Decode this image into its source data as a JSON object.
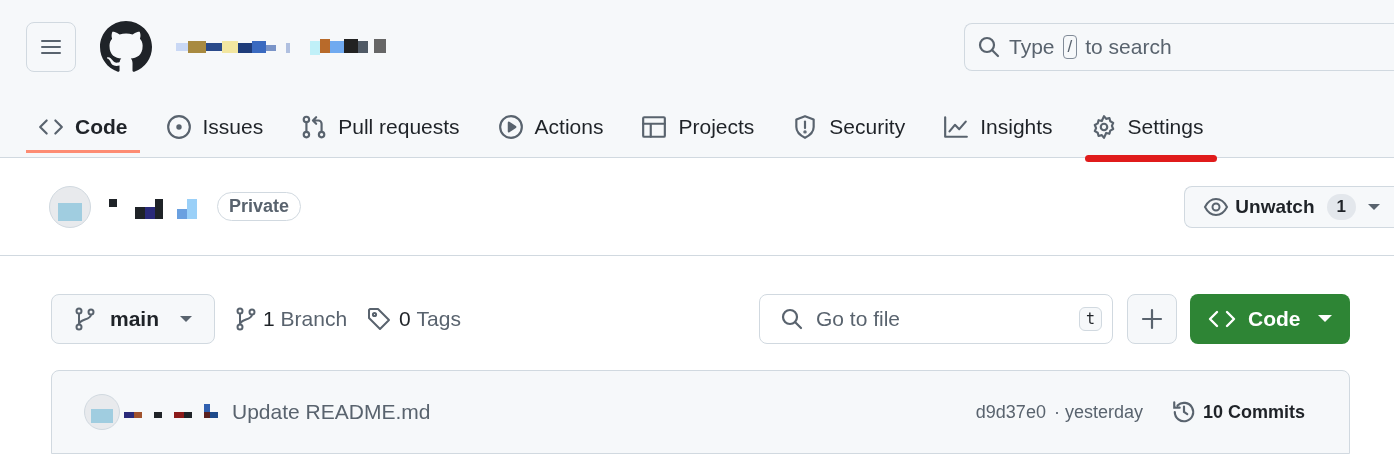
{
  "header": {
    "search": {
      "placeholder_before": "Type",
      "shortcut": "/",
      "placeholder_after": "to search"
    }
  },
  "tabs": [
    {
      "label": "Code",
      "selected": true,
      "highlighted": false
    },
    {
      "label": "Issues",
      "selected": false,
      "highlighted": false
    },
    {
      "label": "Pull requests",
      "selected": false,
      "highlighted": false
    },
    {
      "label": "Actions",
      "selected": false,
      "highlighted": false
    },
    {
      "label": "Projects",
      "selected": false,
      "highlighted": false
    },
    {
      "label": "Security",
      "selected": false,
      "highlighted": false
    },
    {
      "label": "Insights",
      "selected": false,
      "highlighted": false
    },
    {
      "label": "Settings",
      "selected": false,
      "highlighted": true
    }
  ],
  "repo": {
    "visibility": "Private",
    "watch": {
      "label": "Unwatch",
      "count": "1"
    }
  },
  "toolbar": {
    "branch": "main",
    "branches": {
      "count": "1",
      "label": "Branch"
    },
    "tags": {
      "count": "0",
      "label": "Tags"
    },
    "file_search": {
      "placeholder": "Go to file",
      "shortcut": "t"
    },
    "code_button": "Code"
  },
  "latest_commit": {
    "message": "Update README.md",
    "hash": "d9d37e0",
    "time": "· yesterday",
    "commits": "10 Commits"
  }
}
